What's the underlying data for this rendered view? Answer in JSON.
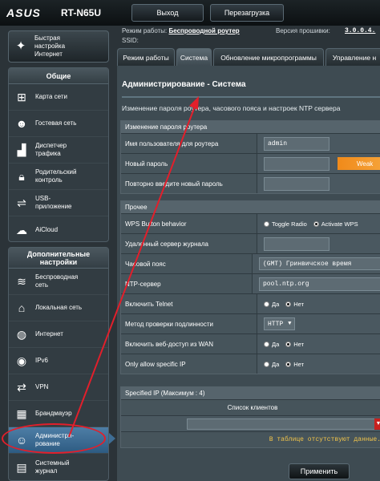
{
  "header": {
    "brand": "ASUS",
    "model": "RT-N65U",
    "logout_label": "Выход",
    "reboot_label": "Перезагрузка"
  },
  "info": {
    "mode_label": "Режим работы:",
    "mode_value": "Беспроводной роутер",
    "fw_label": "Версия прошивки:",
    "fw_value": "3.0.0.4.",
    "ssid_label": "SSID:"
  },
  "sidebar": {
    "quick_label_1": "Быстрая",
    "quick_label_2": "настройка",
    "quick_label_3": "Интернет",
    "general_header": "Общие",
    "general_items": [
      {
        "l1": "Карта сети",
        "l2": ""
      },
      {
        "l1": "Гостевая сеть",
        "l2": ""
      },
      {
        "l1": "Диспетчер",
        "l2": "трафика"
      },
      {
        "l1": "Родительский",
        "l2": "контроль"
      },
      {
        "l1": "USB-",
        "l2": "приложение"
      },
      {
        "l1": "AiCloud",
        "l2": ""
      }
    ],
    "adv_header_1": "Дополнительные",
    "adv_header_2": "настройки",
    "adv_items": [
      {
        "l1": "Беспроводная",
        "l2": "сеть"
      },
      {
        "l1": "Локальная сеть",
        "l2": ""
      },
      {
        "l1": "Интернет",
        "l2": ""
      },
      {
        "l1": "IPv6",
        "l2": ""
      },
      {
        "l1": "VPN",
        "l2": ""
      },
      {
        "l1": "Брандмауэр",
        "l2": ""
      },
      {
        "l1": "Администри-",
        "l2": "рование"
      },
      {
        "l1": "Системный",
        "l2": "журнал"
      }
    ]
  },
  "tabs": [
    "Режим работы",
    "Система",
    "Обновление микропрограммы",
    "Управление н"
  ],
  "page": {
    "title": "Администрирование - Система",
    "description": "Изменение пароля роутера, часового пояса и настроек NTP сервера"
  },
  "password_section": {
    "header": "Изменение пароля роутера",
    "username_label": "Имя пользователя для роутера",
    "username_value": "admin",
    "new_password_label": "Новый пароль",
    "strength_label": "Weak",
    "repeat_password_label": "Повторно введите новый пароль"
  },
  "misc_section": {
    "header": "Прочее",
    "wps_label": "WPS Button behavior",
    "wps_option_1": "Toggle Radio",
    "wps_option_2": "Activate WPS",
    "syslog_label": "Удаленный сервер журнала",
    "tz_label": "Часовой пояс",
    "tz_value": "(GMT) Гринвичское время",
    "ntp_label": "NTP-сервер",
    "ntp_value": "pool.ntp.org",
    "telnet_label": "Включить Telnet",
    "yes": "Да",
    "no": "Нет",
    "auth_label": "Метод проверки подлинности",
    "auth_value": "HTTP",
    "wan_web_label": "Включить веб-доступ из WAN",
    "specific_ip_label": "Only allow specific IP"
  },
  "specified_ip": {
    "header": "Specified IP (Максимум : 4)",
    "clients_header": "Список клиентов",
    "empty_text": "В таблице отсутствуют данные."
  },
  "apply_label": "Применить"
}
